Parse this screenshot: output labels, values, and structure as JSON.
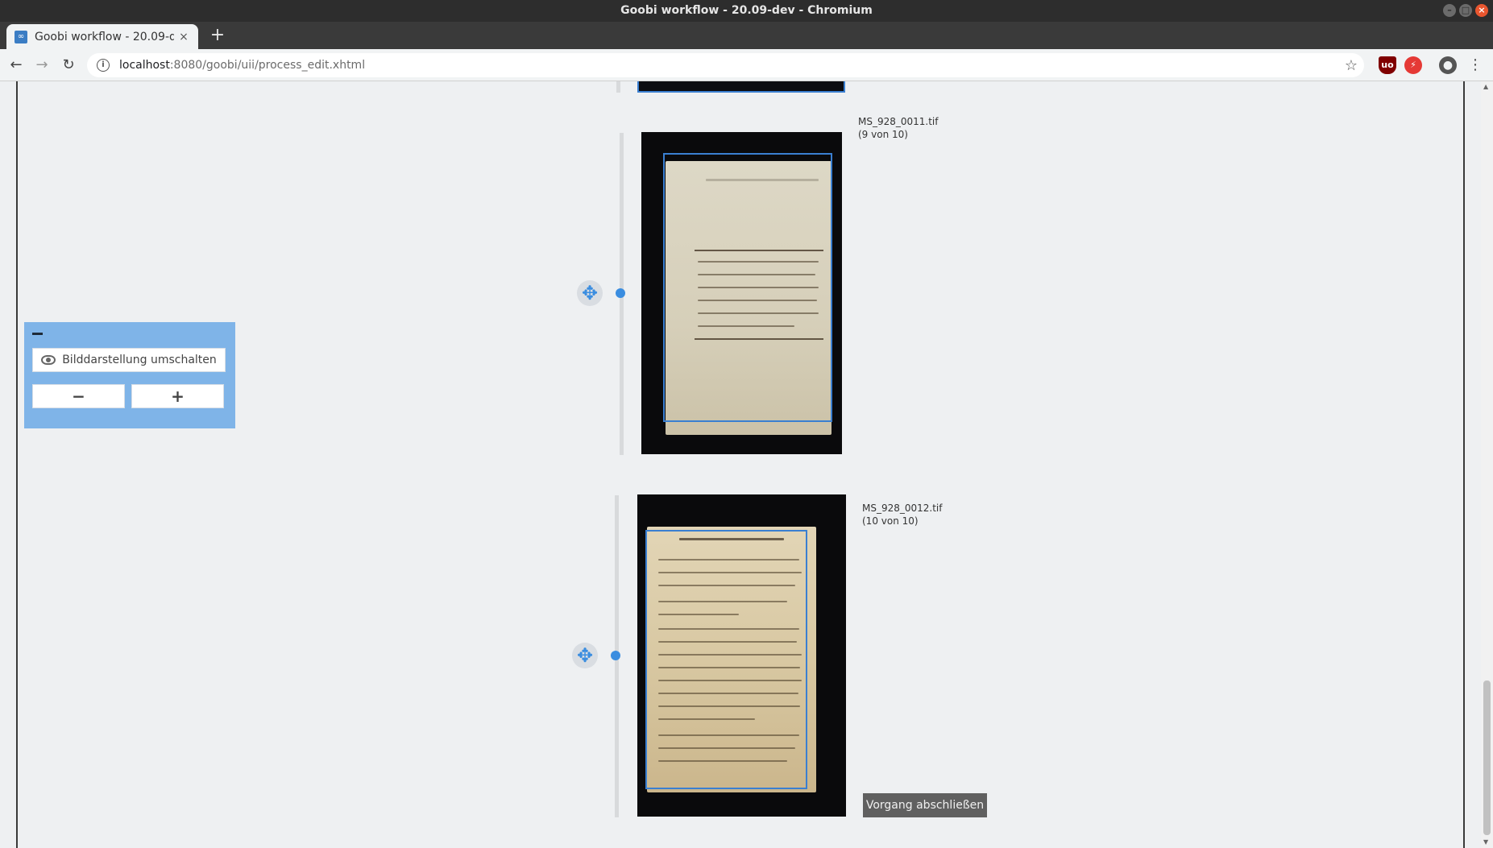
{
  "window": {
    "title": "Goobi workflow - 20.09-dev - Chromium"
  },
  "tab": {
    "title": "Goobi workflow - 20.09-dev",
    "favicon": "∞",
    "close": "×"
  },
  "address_bar": {
    "url_host": "localhost",
    "url_path": ":8080/goobi/uii/process_edit.xhtml"
  },
  "panel": {
    "toggle_label": "Bilddarstellung umschalten",
    "zoom_out_label": "−",
    "zoom_in_label": "+"
  },
  "images": [
    {
      "filename": "MS_928_0011.tif",
      "position": "(9 von 10)"
    },
    {
      "filename": "MS_928_0012.tif",
      "position": "(10 von 10)"
    }
  ],
  "actions": {
    "finish_label": "Vorgang abschließen"
  },
  "colors": {
    "accent": "#3a8de0",
    "panel": "#7fb4e8",
    "finish_button": "#606060"
  }
}
